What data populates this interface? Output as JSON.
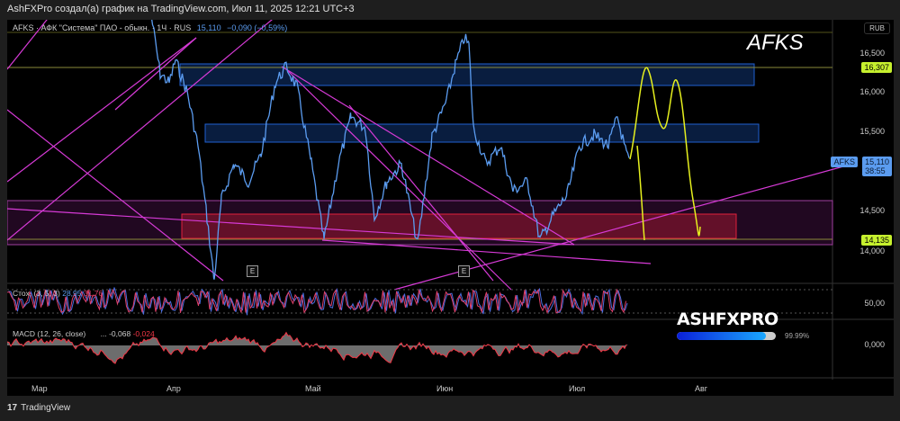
{
  "header": {
    "title": "AshFXPro создал(а) график на TradingView.com, Июл 11, 2025 12:21 UTC+3"
  },
  "legend": {
    "symbol": "AFKS · АФК \"Система\" ПАО - обыкн. · 1Ч · RUS",
    "price": "15,110",
    "change": "−0,090 (−0,59%)"
  },
  "ticker_watermark": "AFKS",
  "price_axis": {
    "currency": "RUB",
    "labels": [
      "16,500",
      "16,000",
      "15,500",
      "14,500",
      "14,000"
    ],
    "level_high": "16,307",
    "level_low": "14,135",
    "current_symbol": "AFKS",
    "current_price": "15,110",
    "countdown": "38:55"
  },
  "stoch": {
    "label": "Стох. (3, 5, 3)",
    "k": "28,95",
    "d": "31,76",
    "axis": "50,00"
  },
  "macd": {
    "label": "MACD (12, 26, close)",
    "hist": "...",
    "macd": "-0,068",
    "signal": "-0,024",
    "axis": "0,000"
  },
  "earnings_marker": "E",
  "time_axis": [
    "Мар",
    "Апр",
    "Май",
    "Июн",
    "Июл",
    "Авг"
  ],
  "brand": {
    "name": "ASHFXPRO",
    "progress_percent": 99.99,
    "progress_label": "99.99%"
  },
  "footer": {
    "logo": "17",
    "name": "TradingView"
  },
  "colors": {
    "price_line": "#5b9cf0",
    "projection": "#e6f01e",
    "trendlines": "#d63ad6",
    "zone_blue": "#1f5fd0",
    "zone_red": "#e0203a",
    "level": "#c6f02e"
  }
}
